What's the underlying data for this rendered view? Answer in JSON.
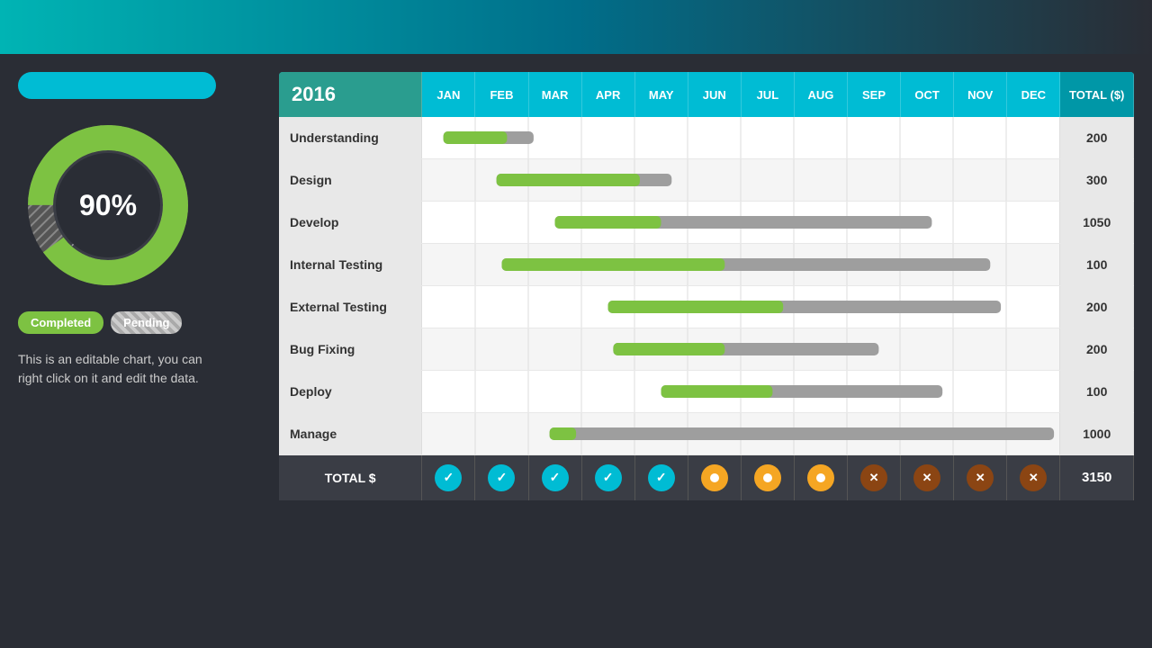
{
  "header": {
    "year": "2016"
  },
  "left_panel": {
    "percentage": "90%",
    "legend_completed": "Completed",
    "legend_pending": "Pending",
    "description": "This is an editable chart, you can right click on it and edit the data."
  },
  "months": [
    "JAN",
    "FEB",
    "MAR",
    "APR",
    "MAY",
    "JUN",
    "JUL",
    "AUG",
    "SEP",
    "OCT",
    "NOV",
    "DEC"
  ],
  "total_header": "TOTAL ($)",
  "total_label": "TOTAL $",
  "total_amount": "3150",
  "tasks": [
    {
      "name": "Understanding",
      "total": "200",
      "bars": [
        {
          "start": 0,
          "width": 0.85,
          "col_start": 0,
          "col_span": 2,
          "type": "completed",
          "offset": 0.05,
          "green_w": 0.55,
          "gray_w": 0.35
        }
      ]
    },
    {
      "name": "Design",
      "total": "300",
      "bars": [
        {
          "col_start": 1,
          "green_w": 0.68,
          "gray_w": 0.22
        }
      ]
    },
    {
      "name": "Develop",
      "total": "1050",
      "bars": [
        {
          "col_start": 2,
          "green_w": 0.4,
          "gray_w": 0.55
        }
      ]
    },
    {
      "name": "Internal Testing",
      "total": "100",
      "bars": [
        {
          "col_start": 1,
          "green_w": 0.55,
          "gray_w": 0.44
        }
      ]
    },
    {
      "name": "External Testing",
      "total": "200",
      "bars": [
        {
          "col_start": 2,
          "green_w": 0.35,
          "gray_w": 0.58
        }
      ]
    },
    {
      "name": "Bug Fixing",
      "total": "200",
      "bars": [
        {
          "col_start": 3,
          "green_w": 0.28,
          "gray_w": 0.36
        }
      ]
    },
    {
      "name": "Deploy",
      "total": "100",
      "bars": [
        {
          "col_start": 4,
          "green_w": 0.28,
          "gray_w": 0.4
        }
      ]
    },
    {
      "name": "Manage",
      "total": "1000",
      "bars": [
        {
          "col_start": 2,
          "green_w": 0.06,
          "gray_w": 0.9
        }
      ]
    }
  ],
  "status_icons": [
    {
      "month": "JAN",
      "type": "check"
    },
    {
      "month": "FEB",
      "type": "check"
    },
    {
      "month": "MAR",
      "type": "check"
    },
    {
      "month": "APR",
      "type": "check"
    },
    {
      "month": "MAY",
      "type": "check"
    },
    {
      "month": "JUN",
      "type": "pending"
    },
    {
      "month": "JUL",
      "type": "pending"
    },
    {
      "month": "AUG",
      "type": "pending"
    },
    {
      "month": "SEP",
      "type": "x"
    },
    {
      "month": "OCT",
      "type": "x"
    },
    {
      "month": "NOV",
      "type": "x"
    },
    {
      "month": "DEC",
      "type": "x"
    }
  ],
  "colors": {
    "teal": "#00bcd4",
    "green": "#7dc242",
    "gray_bar": "#9e9e9e",
    "dark_teal": "#2a9d8f",
    "pending_orange": "#f5a623",
    "x_brown": "#8b4513",
    "header_bg": "#3a3d45"
  }
}
